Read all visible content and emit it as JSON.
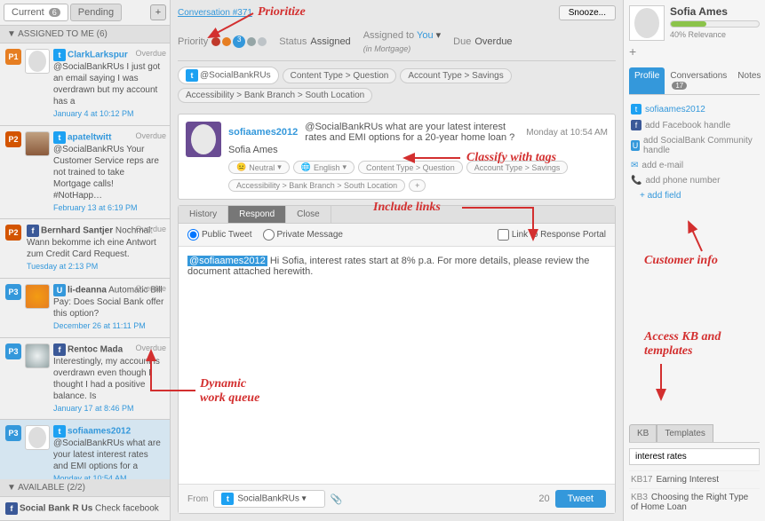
{
  "left": {
    "tabs": {
      "current": "Current",
      "current_badge": "6",
      "pending": "Pending"
    },
    "assigned_header": "ASSIGNED TO ME (6)",
    "available_header": "AVAILABLE (2/2)",
    "items": [
      {
        "priority": "P1",
        "icon": "tw",
        "handle": "ClarkLarkspur",
        "mention": "@SocialBankRUs",
        "text": "I just got an email saying I was overdrawn but my account has a",
        "time": "January 4 at 10:12 PM",
        "overdue": "Overdue"
      },
      {
        "priority": "P2",
        "icon": "tw",
        "handle": "apateltwitt",
        "mention": "@SocialBankRUs",
        "text": "Your Customer Service reps are not trained to take Mortgage calls! #NotHapp…",
        "time": "February 13 at 6:19 PM",
        "overdue": "Overdue"
      },
      {
        "priority": "P2",
        "icon": "fb",
        "handle": "Bernhard Santjer",
        "text": "Nochmal: Wann bekomme ich eine Antwort zum Credit Card Request.",
        "time": "Tuesday at 2:13 PM",
        "overdue": "Overdue"
      },
      {
        "priority": "P3",
        "icon": "u",
        "handle": "li-deanna",
        "text": "Automatic Bill Pay: Does Social Bank offer this option?",
        "time": "December 26 at 11:11 PM",
        "overdue": "Overdue"
      },
      {
        "priority": "P3",
        "icon": "fb",
        "handle": "Rentoc Mada",
        "text": "Interestingly, my account is overdrawn even though I thought I had a positive balance. Is",
        "time": "January 17 at 8:46 PM",
        "overdue": "Overdue"
      },
      {
        "priority": "P3",
        "icon": "tw",
        "handle": "sofiaames2012",
        "mention": "@SocialBankRUs",
        "text": "what are your latest interest rates and EMI options for a",
        "time": "Monday at 10:54 AM",
        "overdue": ""
      }
    ],
    "available_item": {
      "icon": "fb",
      "handle": "Social Bank R Us",
      "text": "Check facebook"
    }
  },
  "center": {
    "conv_link": "Conversation #371",
    "snooze": "Snooze...",
    "meta": {
      "priority_label": "Priority",
      "priority_num": "3",
      "status_label": "Status",
      "status_value": "Assigned",
      "assigned_label": "Assigned to",
      "assigned_value": "You",
      "assigned_sub": "(in Mortgage)",
      "due_label": "Due",
      "due_value": "Overdue"
    },
    "top_tags": [
      "@SocialBankRUs",
      "Content Type > Question",
      "Account Type > Savings",
      "Accessibility > Bank Branch > South Location"
    ],
    "convo": {
      "handle": "sofiaames2012",
      "text": "@SocialBankRUs what are your latest interest rates and EMI options for a 20-year home loan ?",
      "time": "Monday at 10:54 AM",
      "name": "Sofia Ames",
      "sentiment": "Neutral",
      "language": "English",
      "tags": [
        "Content Type > Question",
        "Account Type > Savings",
        "Accessibility > Bank Branch > South Location"
      ]
    },
    "resp_tabs": {
      "history": "History",
      "respond": "Respond",
      "close": "Close"
    },
    "resp_opts": {
      "public": "Public Tweet",
      "private": "Private Message",
      "link_portal": "Link to Response Portal"
    },
    "resp_body_mention": "@sofiaames2012",
    "resp_body_text": " Hi Sofia, interest rates start at 8% p.a. For more details, please review the document attached herewith.",
    "footer": {
      "from": "From",
      "account": "SocialBankRUs",
      "count": "20",
      "tweet": "Tweet"
    }
  },
  "right": {
    "name": "Sofia Ames",
    "relevance": "40% Relevance",
    "tabs": {
      "profile": "Profile",
      "conversations": "Conversations",
      "conv_badge": "17",
      "notes": "Notes"
    },
    "info": {
      "twitter": "sofiaames2012",
      "fb": "add Facebook handle",
      "community": "add SocialBank Community handle",
      "email": "add e-mail",
      "phone": "add phone number",
      "addfield": "+ add field"
    },
    "kb": {
      "tab1": "KB",
      "tab2": "Templates",
      "search": "interest rates",
      "items": [
        {
          "id": "KB17",
          "title": "Earning Interest"
        },
        {
          "id": "KB3",
          "title": "Choosing the Right Type of Home Loan"
        }
      ]
    }
  },
  "annotations": {
    "prioritize": "Prioritize",
    "classify": "Classify with tags",
    "links": "Include links",
    "queue": "Dynamic\nwork queue",
    "customer": "Customer info",
    "kb": "Access KB and\ntemplates"
  }
}
